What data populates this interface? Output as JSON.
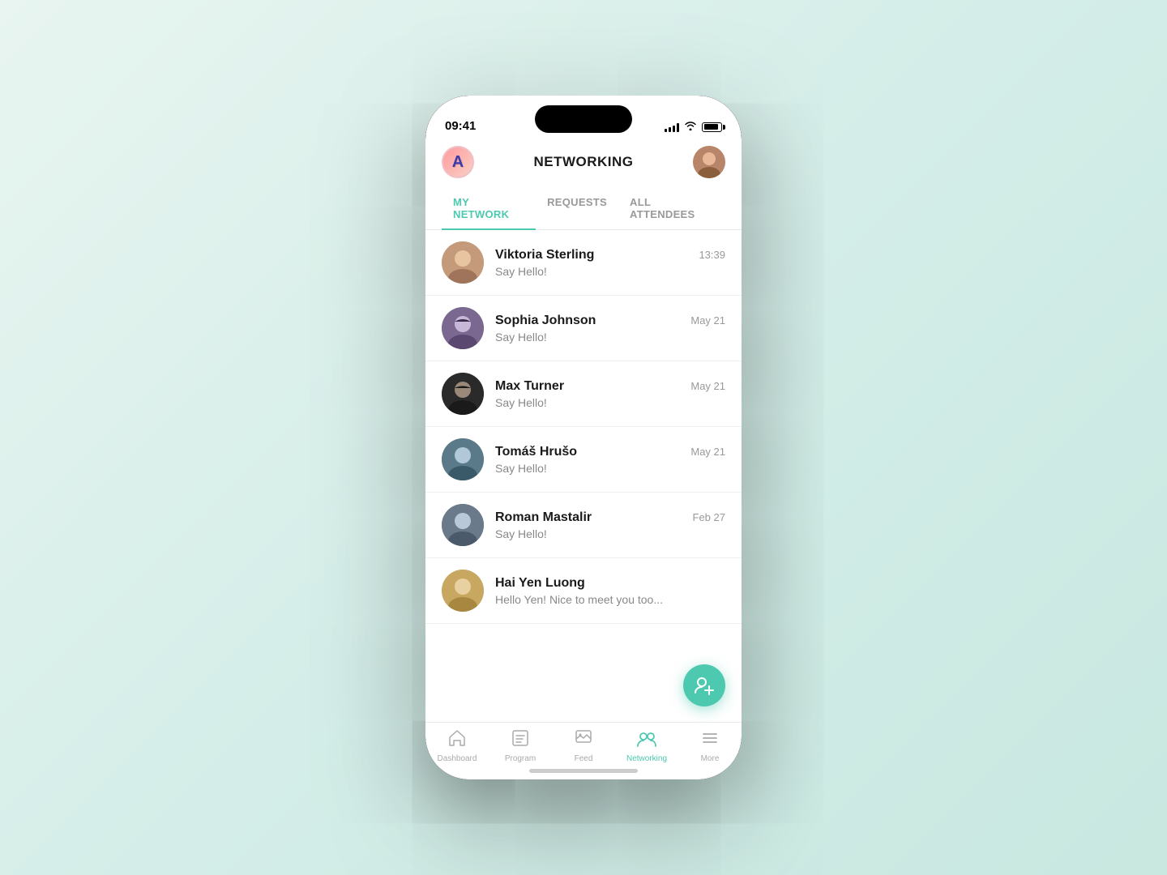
{
  "status_bar": {
    "time": "09:41"
  },
  "header": {
    "title": "NETWORKING",
    "left_avatar_letter": "A",
    "right_avatar": "👤"
  },
  "sub_tabs": [
    {
      "label": "MY NETWORK",
      "active": true
    },
    {
      "label": "REQUESTS",
      "active": false
    },
    {
      "label": "ALL ATTENDEES",
      "active": false
    }
  ],
  "contacts": [
    {
      "name": "Viktoria Sterling",
      "time": "13:39",
      "message": "Say Hello!",
      "avatar_class": "avatar-viktoria",
      "emoji": "🧑"
    },
    {
      "name": "Sophia Johnson",
      "time": "May 21",
      "message": "Say Hello!",
      "avatar_class": "avatar-sophia",
      "emoji": "👩"
    },
    {
      "name": "Max Turner",
      "time": "May 21",
      "message": "Say Hello!",
      "avatar_class": "avatar-max",
      "emoji": "🧔"
    },
    {
      "name": "Tomáš Hrušo",
      "time": "May 21",
      "message": "Say Hello!",
      "avatar_class": "avatar-tomas",
      "emoji": "🧑"
    },
    {
      "name": "Roman Mastalir",
      "time": "Feb 27",
      "message": "Say Hello!",
      "avatar_class": "avatar-roman",
      "emoji": "🧑"
    },
    {
      "name": "Hai Yen Luong",
      "time": "",
      "message": "Hello Yen! Nice to meet you too...",
      "avatar_class": "avatar-haiyen",
      "emoji": "🧑"
    }
  ],
  "bottom_nav": [
    {
      "label": "Dashboard",
      "icon": "⌂",
      "active": false
    },
    {
      "label": "Program",
      "icon": "📋",
      "active": false
    },
    {
      "label": "Feed",
      "icon": "🖼",
      "active": false
    },
    {
      "label": "Networking",
      "icon": "👥",
      "active": true
    },
    {
      "label": "More",
      "icon": "☰",
      "active": false
    }
  ],
  "fab": {
    "icon": "👤+"
  }
}
